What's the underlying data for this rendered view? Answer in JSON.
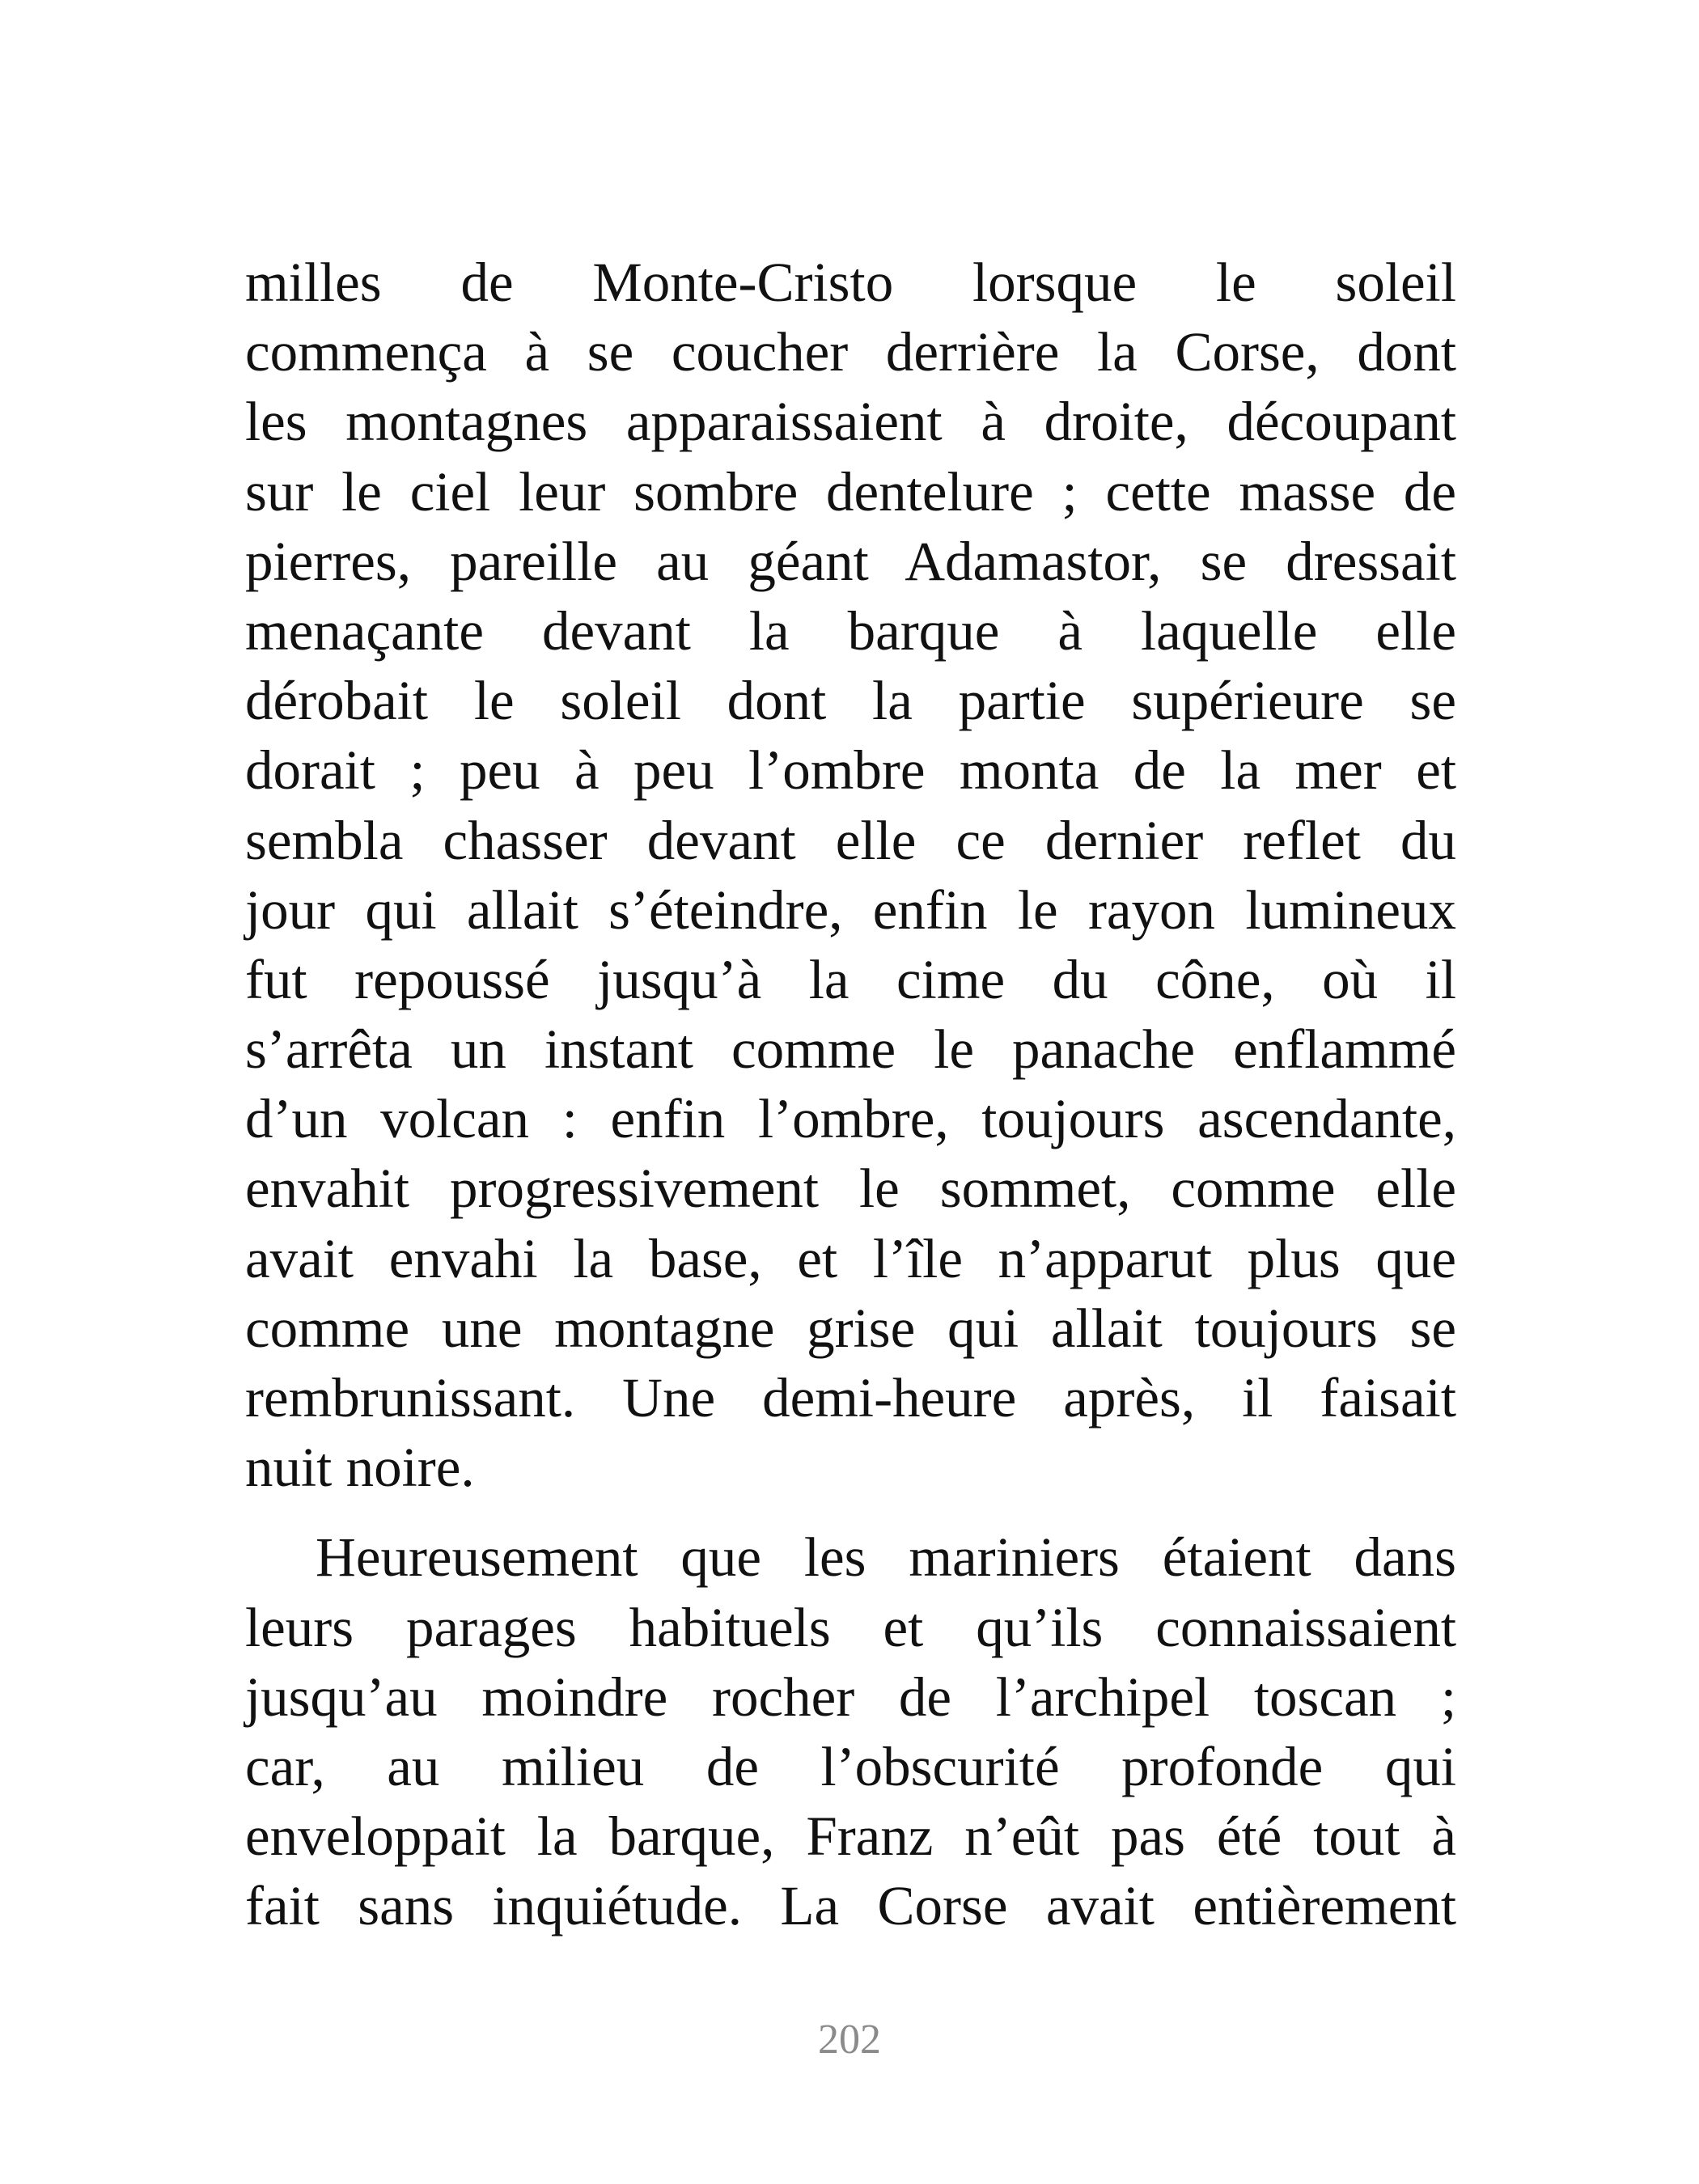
{
  "paragraphs": [
    {
      "lines": [
        "milles de Monte-Cristo lorsque le soleil",
        "commença à se coucher derrière la Corse, dont",
        "les montagnes apparaissaient à droite, découpant",
        "sur le ciel leur sombre dentelure ; cette masse de",
        "pierres, pareille au géant Adamastor, se dressait",
        "menaçante devant la barque à laquelle elle",
        "dérobait le soleil dont la partie supérieure se",
        "dorait ; peu à peu l’ombre monta de la mer et",
        "sembla chasser devant elle ce dernier reflet du",
        "jour qui allait s’éteindre, enfin le rayon lumineux",
        "fut repoussé jusqu’à la cime du cône, où il",
        "s’arrêta un instant comme le panache enflammé",
        "d’un volcan : enfin l’ombre, toujours ascendante,",
        "envahit progressivement le sommet, comme elle",
        "avait envahi la base, et l’île n’apparut plus que",
        "comme une montagne grise qui allait toujours se",
        "rembrunissant. Une demi-heure après, il faisait",
        "nuit noire."
      ]
    },
    {
      "lines": [
        "Heureusement que les mariniers étaient dans",
        "leurs parages habituels et qu’ils connaissaient",
        "jusqu’au moindre rocher de l’archipel toscan ;",
        "car, au milieu de l’obscurité profonde qui",
        "enveloppait la barque, Franz n’eût pas été tout à",
        "fait sans inquiétude. La Corse avait entièrement"
      ]
    }
  ],
  "page_number": "202"
}
